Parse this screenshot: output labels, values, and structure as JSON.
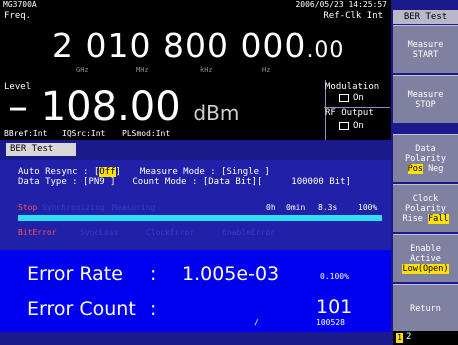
{
  "topbar": {
    "model": "MG3700A",
    "datetime": "2006/05/23  14:25:57"
  },
  "frequency": {
    "label": "Freq.",
    "ref_clk": "Ref-Clk Int",
    "value_main": "2 010 800 000",
    "value_dec": ".00",
    "units": [
      "GHz",
      "MHz",
      "kHz",
      "Hz"
    ]
  },
  "level": {
    "label": "Level",
    "value": "– 108.00",
    "unit": "dBm",
    "modulation_label": "Modulation",
    "modulation_state": "On",
    "rf_output_label": "RF Output",
    "rf_output_state": "On"
  },
  "status_line": {
    "bbref": "BBref:Int",
    "iqsrc": "IQSrc:Int",
    "plsmod": "PLSmod:Int"
  },
  "ber": {
    "title": "BER Test",
    "auto_resync_label": "Auto Resync : [",
    "auto_resync_value": "Off",
    "auto_resync_close": "]",
    "data_type_label": "Data Type   : [PN9 ]",
    "measure_mode": "Measure Mode : [Single     ]",
    "count_mode": "Count Mode   : [Data Bit][",
    "count_value": "100000 Bit]",
    "states": {
      "stop": "Stop",
      "synchronizing": "Synchronizing",
      "measuring": "Measuring"
    },
    "time": {
      "hours": "0h",
      "minutes": "0min",
      "seconds": "8.3s",
      "percent": "100%"
    },
    "progress": 1.0,
    "errors": {
      "bit_error": "BitError",
      "sync_loss": "SyncLoss",
      "clock_error": "ClockError",
      "enable_error": "EnableError"
    },
    "error_rate_label": "Error Rate",
    "error_rate_colon": ":",
    "error_rate_value": "1.005e-03",
    "error_rate_percent": "0.100%",
    "error_count_label": "Error Count",
    "error_count_colon": ":",
    "error_count_value": "101",
    "error_count_slash": "/",
    "error_count_total": "100528"
  },
  "softkeys": {
    "title": "BER Test",
    "measure_start": [
      "Measure",
      "START"
    ],
    "measure_stop": [
      "Measure",
      "STOP"
    ],
    "data_polarity": {
      "line1": "Data",
      "line2": "Polarity",
      "pos": "Pos",
      "neg": "Neg"
    },
    "clock_polarity": {
      "line1": "Clock",
      "line2": "Polarity",
      "rise": "Rise",
      "fall": "Fall"
    },
    "enable_active": {
      "line1": "Enable",
      "line2": "Active",
      "value": "Low(Open)"
    },
    "return": "Return",
    "page_current": "1",
    "page_other": "2"
  },
  "colors": {
    "highlight": "#ffe000",
    "progress": "#30e0f0",
    "result_bg": "#0000f0",
    "error_red": "#ff5050"
  }
}
